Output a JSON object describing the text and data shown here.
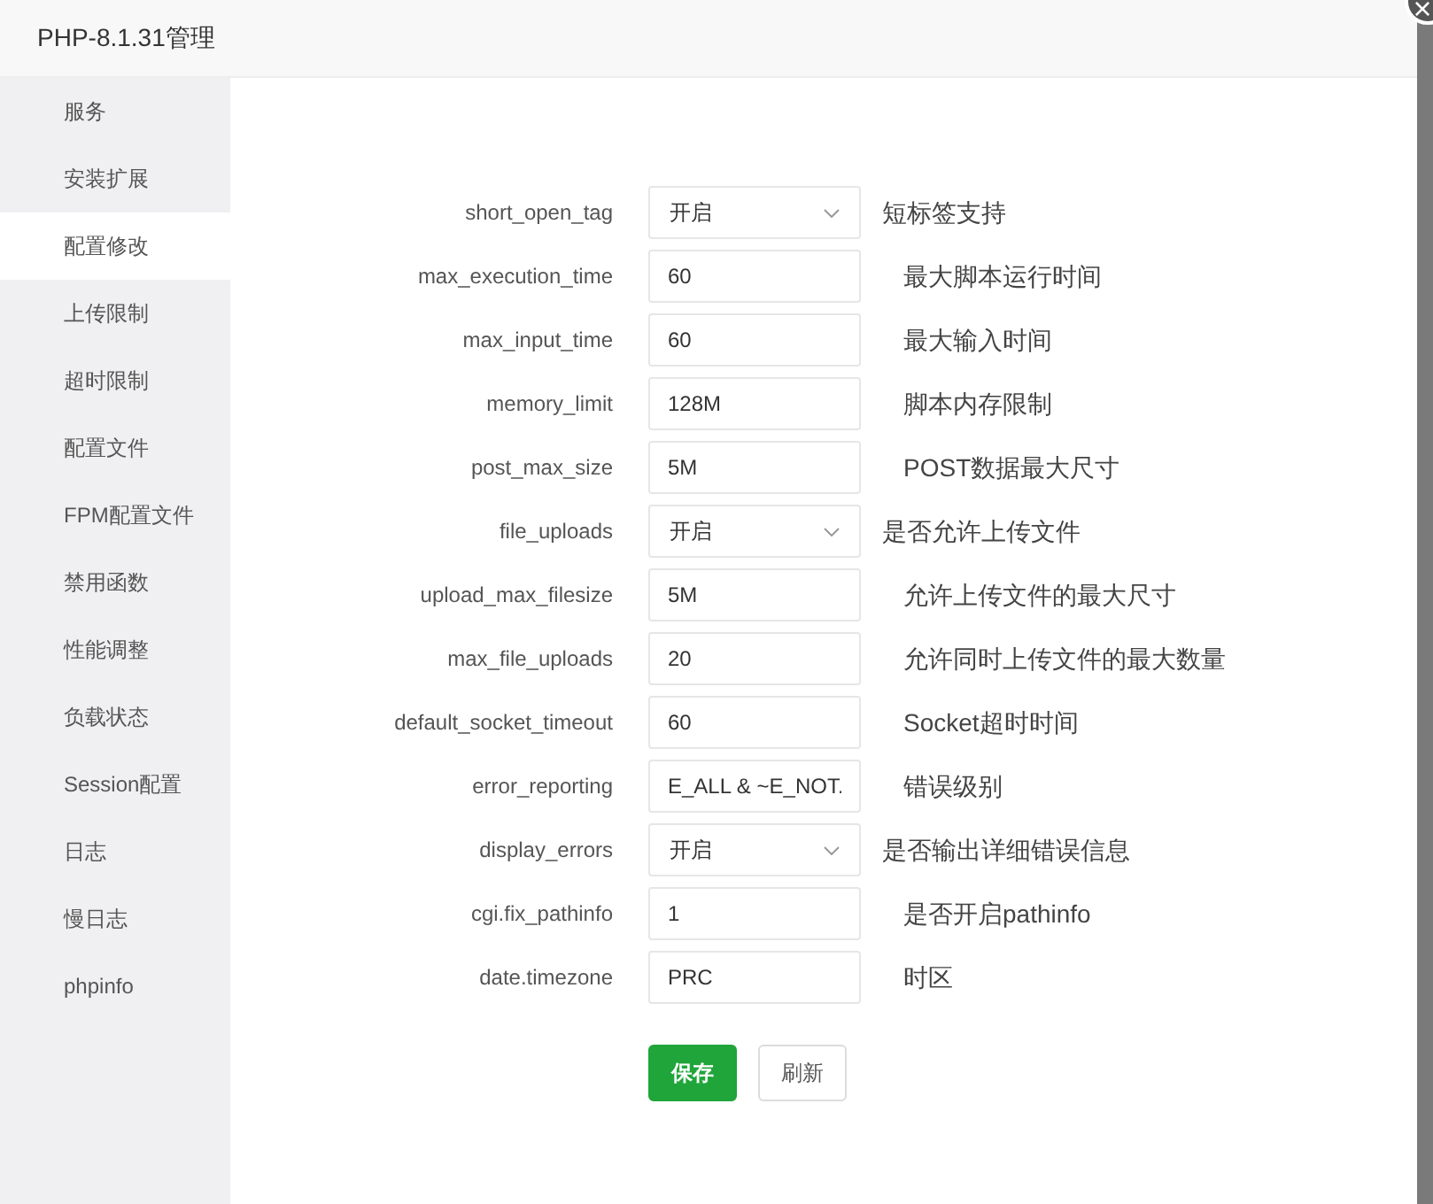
{
  "window": {
    "title": "PHP-8.1.31管理",
    "close": "×"
  },
  "sidebar": {
    "items": [
      {
        "label": "服务",
        "selected": false
      },
      {
        "label": "安装扩展",
        "selected": false
      },
      {
        "label": "配置修改",
        "selected": true
      },
      {
        "label": "上传限制",
        "selected": false
      },
      {
        "label": "超时限制",
        "selected": false
      },
      {
        "label": "配置文件",
        "selected": false
      },
      {
        "label": "FPM配置文件",
        "selected": false
      },
      {
        "label": "禁用函数",
        "selected": false
      },
      {
        "label": "性能调整",
        "selected": false
      },
      {
        "label": "负载状态",
        "selected": false
      },
      {
        "label": "Session配置",
        "selected": false
      },
      {
        "label": "日志",
        "selected": false
      },
      {
        "label": "慢日志",
        "selected": false
      },
      {
        "label": "phpinfo",
        "selected": false
      }
    ]
  },
  "form": {
    "rows": [
      {
        "kind": "select",
        "label": "short_open_tag",
        "value": "开启",
        "description": "短标签支持"
      },
      {
        "kind": "input",
        "label": "max_execution_time",
        "value": "60",
        "description": "最大脚本运行时间"
      },
      {
        "kind": "input",
        "label": "max_input_time",
        "value": "60",
        "description": "最大输入时间"
      },
      {
        "kind": "input",
        "label": "memory_limit",
        "value": "128M",
        "description": "脚本内存限制"
      },
      {
        "kind": "input",
        "label": "post_max_size",
        "value": "5M",
        "description": "POST数据最大尺寸"
      },
      {
        "kind": "select",
        "label": "file_uploads",
        "value": "开启",
        "description": "是否允许上传文件"
      },
      {
        "kind": "input",
        "label": "upload_max_filesize",
        "value": "5M",
        "description": "允许上传文件的最大尺寸"
      },
      {
        "kind": "input",
        "label": "max_file_uploads",
        "value": "20",
        "description": "允许同时上传文件的最大数量"
      },
      {
        "kind": "input",
        "label": "default_socket_timeout",
        "value": "60",
        "description": "Socket超时时间"
      },
      {
        "kind": "input",
        "label": "error_reporting",
        "value": "E_ALL & ~E_NOT.",
        "description": "错误级别"
      },
      {
        "kind": "select",
        "label": "display_errors",
        "value": "开启",
        "description": "是否输出详细错误信息"
      },
      {
        "kind": "input",
        "label": "cgi.fix_pathinfo",
        "value": "1",
        "description": "是否开启pathinfo"
      },
      {
        "kind": "input",
        "label": "date.timezone",
        "value": "PRC",
        "description": "时区"
      }
    ],
    "buttons": [
      {
        "kind": "primary",
        "label": "保存"
      },
      {
        "kind": "default",
        "label": "刷新"
      }
    ]
  }
}
